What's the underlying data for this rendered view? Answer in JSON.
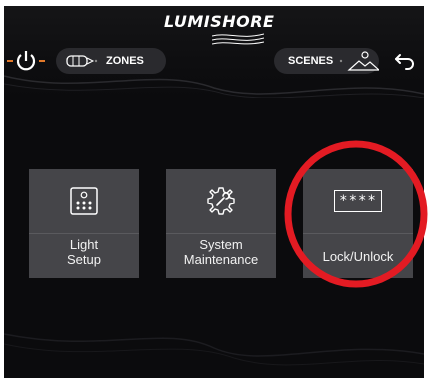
{
  "header": {
    "logo_text": "LUMISHORE",
    "zones_label": "ZONES",
    "scenes_label": "SCENES"
  },
  "tiles": [
    {
      "label_line1": "Light",
      "label_line2": "Setup",
      "icon": "light-panel-icon"
    },
    {
      "label_line1": "System",
      "label_line2": "Maintenance",
      "icon": "gear-wrench-icon"
    },
    {
      "label_line1": "Lock/Unlock",
      "label_line2": "",
      "icon": "password-field-icon",
      "icon_text": "****"
    }
  ],
  "colors": {
    "background": "#0b0b0d",
    "tile": "#454549",
    "pill": "#2a2a2e",
    "power_accent": "#e2792a",
    "annotation_circle": "#e31b23"
  },
  "annotation": {
    "shape": "circle",
    "target": "Lock/Unlock"
  }
}
